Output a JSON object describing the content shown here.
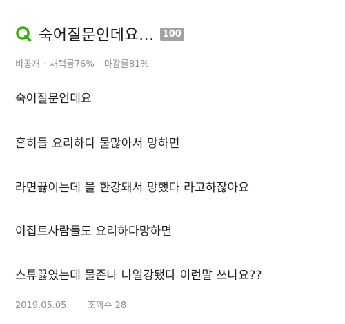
{
  "post": {
    "icon": "q-icon",
    "accent_color": "#2db400",
    "title": "숙어질문인데요...",
    "points": "100",
    "meta": {
      "visibility": "비공개",
      "adoption_rate": "채택률76%",
      "closing_rate": "마감률81%"
    },
    "body_lines": [
      "숙어질문인데요",
      "흔히들 요리하다 물많아서 망하면",
      "라면끓이는데 물 한강돼서 망했다 라고하잖아요",
      "이집트사람들도 요리하다망하면",
      "스튜끓였는데 물존나 나일강됐다 이런말 쓰나요??"
    ],
    "date": "2019.05.05.",
    "views": "조회수 28"
  }
}
